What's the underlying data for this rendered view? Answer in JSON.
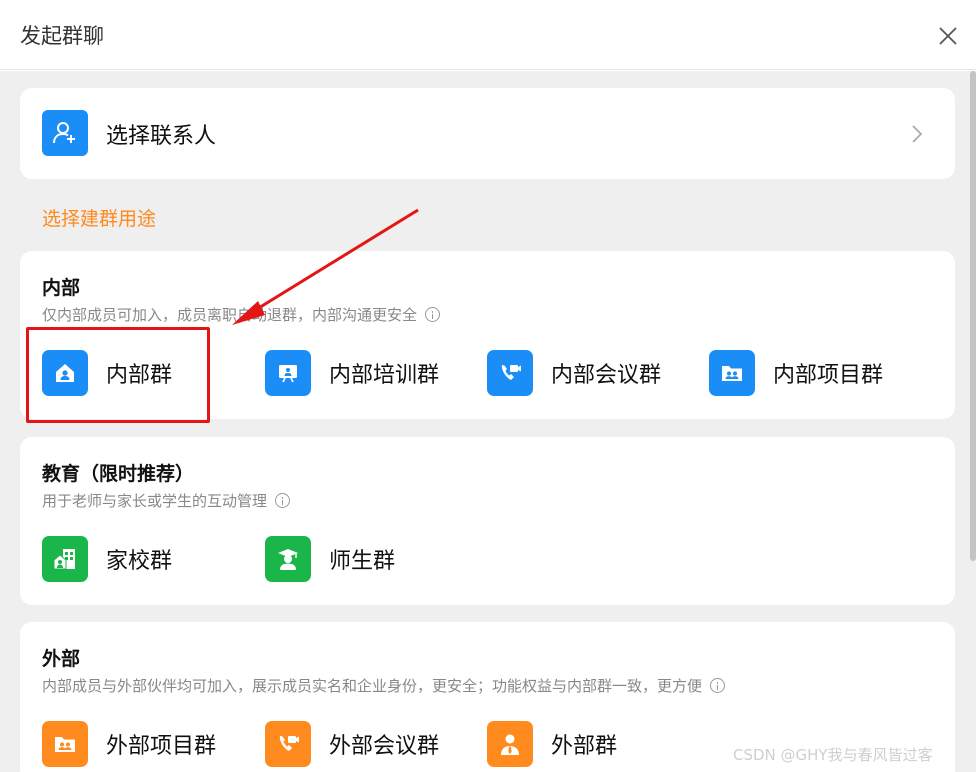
{
  "dialog": {
    "title": "发起群聊"
  },
  "contact": {
    "label": "选择联系人"
  },
  "purpose_label": "选择建群用途",
  "sections": [
    {
      "heading": "内部",
      "desc": "仅内部成员可加入，成员离职自动退群，内部沟通更安全",
      "items": [
        {
          "label": "内部群",
          "icon": "home-icon"
        },
        {
          "label": "内部培训群",
          "icon": "training-board-icon"
        },
        {
          "label": "内部会议群",
          "icon": "video-meeting-icon"
        },
        {
          "label": "内部项目群",
          "icon": "project-folder-icon"
        }
      ]
    },
    {
      "heading": "教育（限时推荐）",
      "desc": "用于老师与家长或学生的互动管理",
      "items": [
        {
          "label": "家校群",
          "icon": "school-building-icon"
        },
        {
          "label": "师生群",
          "icon": "graduate-icon"
        }
      ]
    },
    {
      "heading": "外部",
      "desc": "内部成员与外部伙伴均可加入，展示成员实名和企业身份，更安全；功能权益与内部群一致，更方便",
      "items": [
        {
          "label": "外部项目群",
          "icon": "project-folder-icon"
        },
        {
          "label": "外部会议群",
          "icon": "video-meeting-icon"
        },
        {
          "label": "外部群",
          "icon": "business-person-icon"
        }
      ]
    }
  ],
  "colors": {
    "blue": "#1b8df6",
    "green": "#1bb64a",
    "orange": "#ff8a1e",
    "annotation_red": "#e31515"
  },
  "watermark": "CSDN @GHY我与春风皆过客"
}
